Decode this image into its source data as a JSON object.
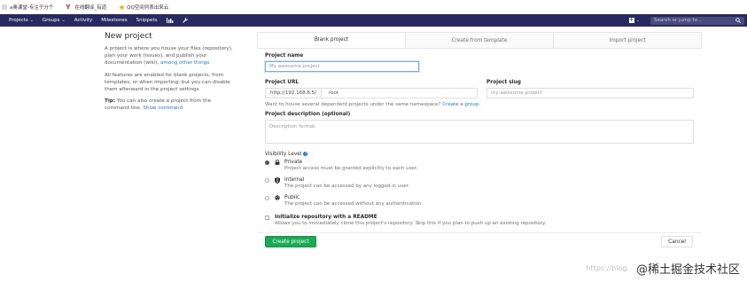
{
  "bookmarks": [
    {
      "label": "a奥课堂-专注于分个",
      "icon": "bookmark-icon"
    },
    {
      "label": "在线翻译_有道",
      "icon": "youdao-icon"
    },
    {
      "label": "QQ空间列表出来云",
      "icon": "qzone-icon"
    }
  ],
  "nav": {
    "items": [
      {
        "label": "Projects",
        "dropdown": true
      },
      {
        "label": "Groups",
        "dropdown": true
      },
      {
        "label": "Activity",
        "dropdown": false
      },
      {
        "label": "Milestones",
        "dropdown": false
      },
      {
        "label": "Snippets",
        "dropdown": false
      }
    ],
    "search_placeholder": "Search or jump to…"
  },
  "intro": {
    "title": "New project",
    "p1": "A project is where you house your files (repository), plan your work (issues), and publish your documentation (wiki),",
    "p1_link": "among other things.",
    "p2": "All features are enabled for blank projects, from templates, or when importing, but you can disable them afterward in the project settings.",
    "tip_label": "Tip:",
    "tip_text": "You can also create a project from the command line.",
    "tip_link": "Show command"
  },
  "tabs": [
    {
      "label": "Blank project",
      "active": true
    },
    {
      "label": "Create from template",
      "active": false
    },
    {
      "label": "Import project",
      "active": false
    }
  ],
  "form": {
    "project_name_label": "Project name",
    "project_name_placeholder": "My awesome project",
    "project_url_label": "Project URL",
    "project_url_prefix": "http://192.168.8.5/",
    "project_url_namespace": "root",
    "project_slug_label": "Project slug",
    "project_slug_placeholder": "my-awesome-project",
    "namespace_help": "Want to house several dependent projects under the same namespace?",
    "namespace_help_link": "Create a group.",
    "description_label": "Project description (optional)",
    "description_placeholder": "Description format",
    "visibility_label": "Visibility Level",
    "visibility_options": [
      {
        "title": "Private",
        "desc": "Project access must be granted explicitly to each user.",
        "icon": "lock-icon",
        "selected": true
      },
      {
        "title": "Internal",
        "desc": "The project can be accessed by any logged in user.",
        "icon": "shield-icon",
        "selected": false
      },
      {
        "title": "Public",
        "desc": "The project can be accessed without any authentication.",
        "icon": "globe-icon",
        "selected": false
      }
    ],
    "readme_label": "Initialize repository with a README",
    "readme_desc": "Allows you to immediately clone this project's repository. Skip this if you plan to push up an existing repository.",
    "create_button": "Create project",
    "cancel_button": "Cancel"
  },
  "watermark": {
    "url": "https://blog.",
    "text": "@稀土掘金技术社区"
  },
  "colors": {
    "navbar": "#292961",
    "accent_link": "#1f78d1",
    "create_button": "#1aaa55"
  }
}
